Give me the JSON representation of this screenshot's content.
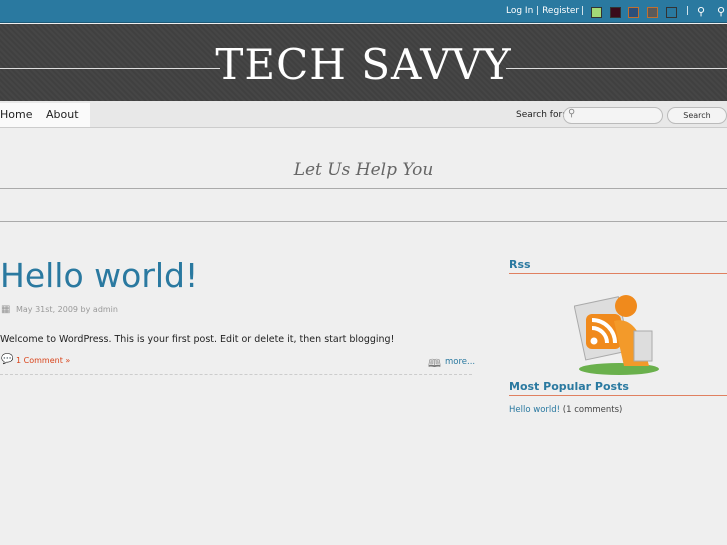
{
  "topbar": {
    "login": "Log In",
    "register": "Register",
    "swatches": [
      "#a3d977",
      "#3a0a1a",
      "#2c4f7a",
      "#5a5a5a",
      "#2a79a0"
    ]
  },
  "header": {
    "title": "TECH SAVVY"
  },
  "nav": {
    "items": [
      "Home",
      "About"
    ],
    "search_label": "Search for:",
    "search_value": "",
    "search_button": "Search"
  },
  "tagline": "Let Us Help You",
  "post": {
    "title": "Hello world!",
    "meta": "May 31st, 2009 by admin",
    "body": "Welcome to WordPress. This is your first post. Edit or delete it, then start blogging!",
    "comments": "1 Comment »",
    "more": "more..."
  },
  "sidebar": {
    "rss_title": "Rss",
    "popular_title": "Most Popular Posts",
    "popular": [
      {
        "title": "Hello world!",
        "count": "(1 comments)"
      }
    ]
  }
}
